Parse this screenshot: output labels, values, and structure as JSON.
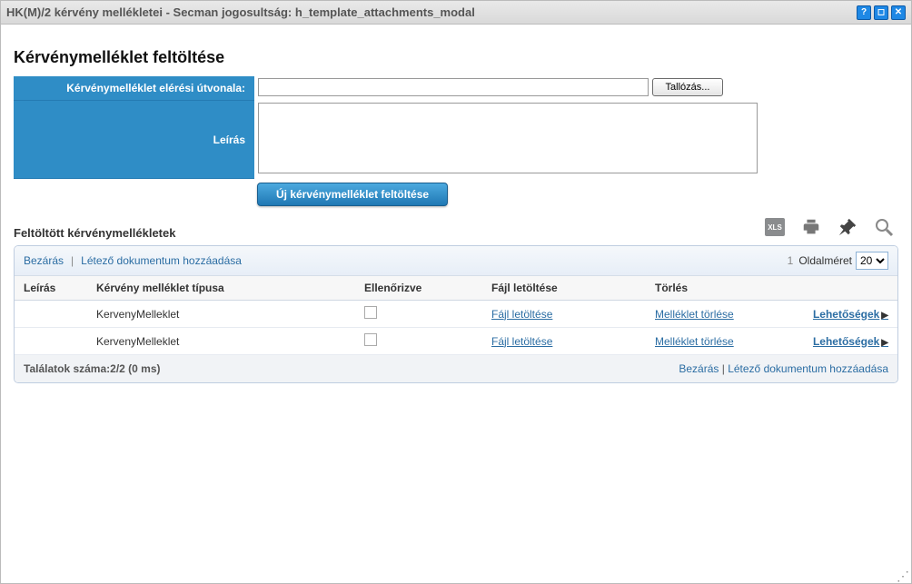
{
  "window": {
    "title": "HK(M)/2 kérvény mellékletei - Secman jogosultság: h_template_attachments_modal"
  },
  "form": {
    "section_title": "Kérvénymelléklet feltöltése",
    "path_label": "Kérvénymelléklet elérési útvonala:",
    "path_value": "",
    "browse_label": "Tallózás...",
    "desc_label": "Leírás",
    "desc_value": "",
    "upload_button": "Új kérvénymelléklet feltöltése"
  },
  "list": {
    "subheading": "Feltöltött kérvénymellékletek",
    "topbar": {
      "close": "Bezárás",
      "add_existing": "Létező dokumentum hozzáadása",
      "page_number": "1",
      "pagesize_label": "Oldalméret",
      "pagesize_value": "20"
    },
    "columns": {
      "desc": "Leírás",
      "type": "Kérvény melléklet típusa",
      "checked": "Ellenőrizve",
      "download": "Fájl letöltése",
      "delete": "Törlés"
    },
    "rows": [
      {
        "desc": "",
        "type": "KervenyMelleklet",
        "download": "Fájl letöltése",
        "delete": "Melléklet törlése",
        "options": "Lehetőségek"
      },
      {
        "desc": "",
        "type": "KervenyMelleklet",
        "download": "Fájl letöltése",
        "delete": "Melléklet törlése",
        "options": "Lehetőségek"
      }
    ],
    "footer": {
      "count_text": "Találatok száma:2/2 (0 ms)",
      "close": "Bezárás",
      "add_existing": "Létező dokumentum hozzáadása"
    }
  },
  "toolbar_icons": {
    "xls": "xls",
    "print": "print",
    "pin": "pin",
    "search": "search"
  }
}
